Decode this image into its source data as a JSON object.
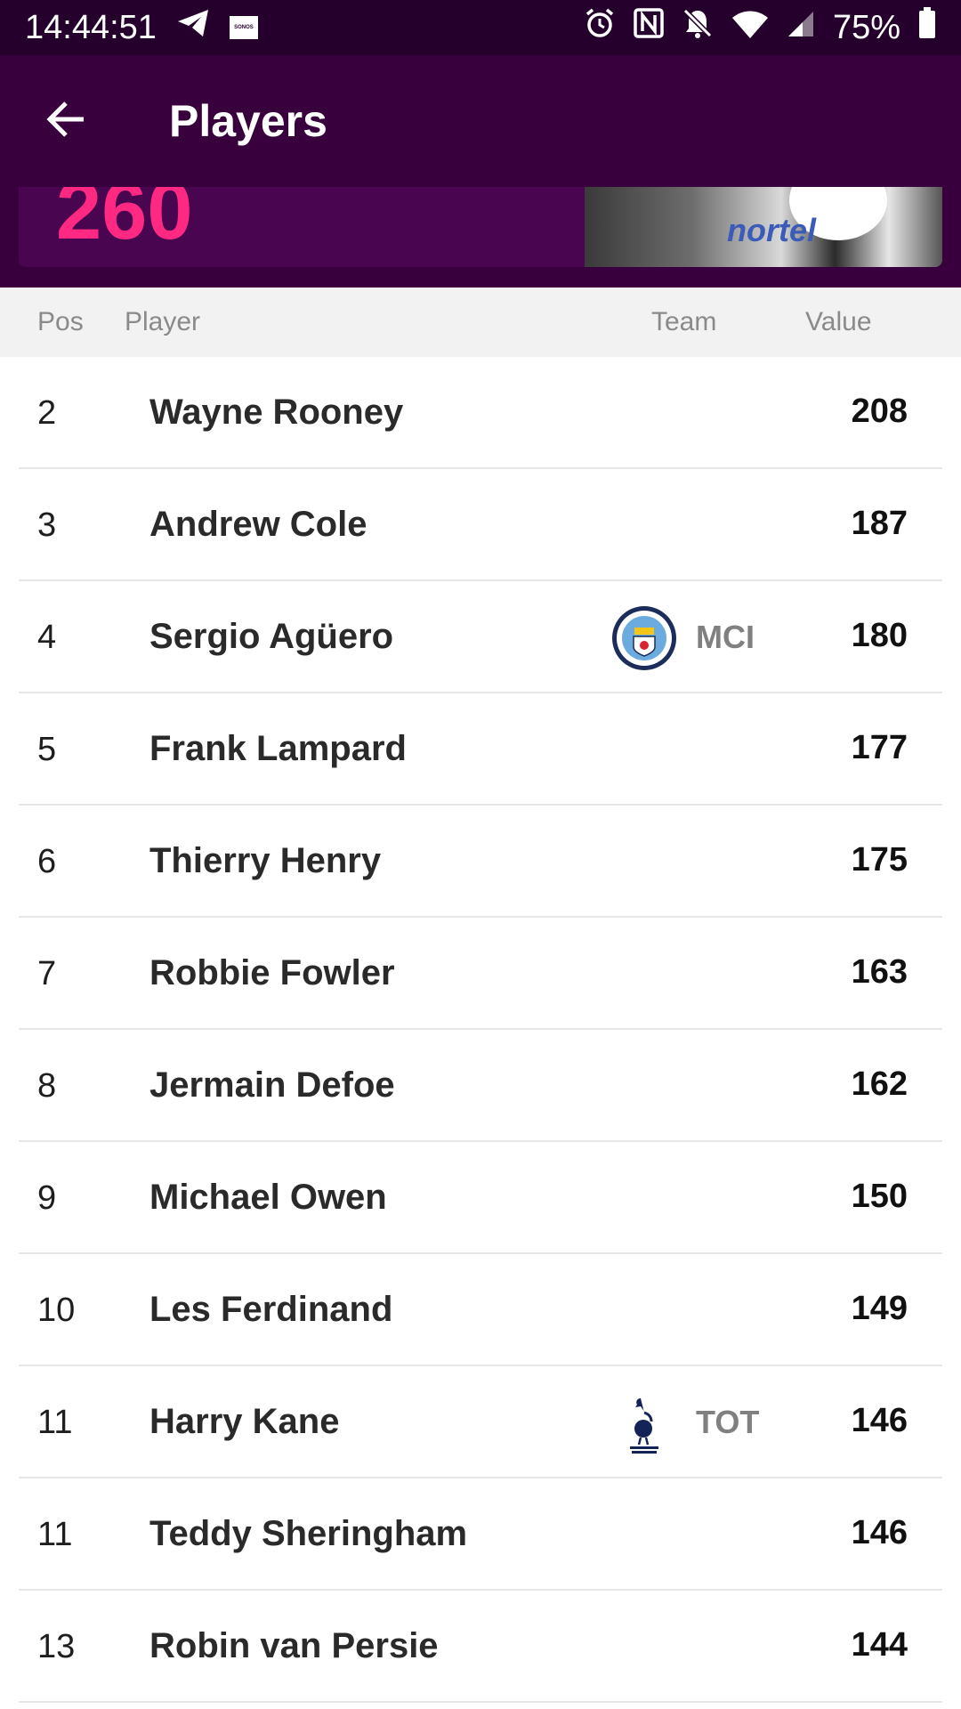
{
  "status_bar": {
    "time": "14:44:51",
    "sonos_label": "SONOS",
    "battery": "75%",
    "icons": [
      "telegram-icon",
      "sonos-icon",
      "alarm-icon",
      "nfc-icon",
      "bell-off-icon",
      "wifi-icon",
      "signal-icon",
      "battery-icon"
    ]
  },
  "app_bar": {
    "title": "Players",
    "back_icon": "arrow-left-icon"
  },
  "banner": {
    "value": "260",
    "photo_text": "nortel"
  },
  "table": {
    "headers": {
      "pos": "Pos",
      "player": "Player",
      "team": "Team",
      "value": "Value"
    },
    "rows": [
      {
        "pos": "2",
        "name": "Wayne Rooney",
        "team": "",
        "value": "208"
      },
      {
        "pos": "3",
        "name": "Andrew Cole",
        "team": "",
        "value": "187"
      },
      {
        "pos": "4",
        "name": "Sergio Agüero",
        "team": "MCI",
        "crest": "man-city-crest-icon",
        "value": "180"
      },
      {
        "pos": "5",
        "name": "Frank Lampard",
        "team": "",
        "value": "177"
      },
      {
        "pos": "6",
        "name": "Thierry Henry",
        "team": "",
        "value": "175"
      },
      {
        "pos": "7",
        "name": "Robbie Fowler",
        "team": "",
        "value": "163"
      },
      {
        "pos": "8",
        "name": "Jermain Defoe",
        "team": "",
        "value": "162"
      },
      {
        "pos": "9",
        "name": "Michael Owen",
        "team": "",
        "value": "150"
      },
      {
        "pos": "10",
        "name": "Les Ferdinand",
        "team": "",
        "value": "149"
      },
      {
        "pos": "11",
        "name": "Harry Kane",
        "team": "TOT",
        "crest": "spurs-crest-icon",
        "value": "146"
      },
      {
        "pos": "11",
        "name": "Teddy Sheringham",
        "team": "",
        "value": "146"
      },
      {
        "pos": "13",
        "name": "Robin van Persie",
        "team": "",
        "value": "144"
      }
    ]
  },
  "colors": {
    "header_purple": "#38003c",
    "status_purple": "#25002d",
    "accent_pink": "#ff2882"
  }
}
